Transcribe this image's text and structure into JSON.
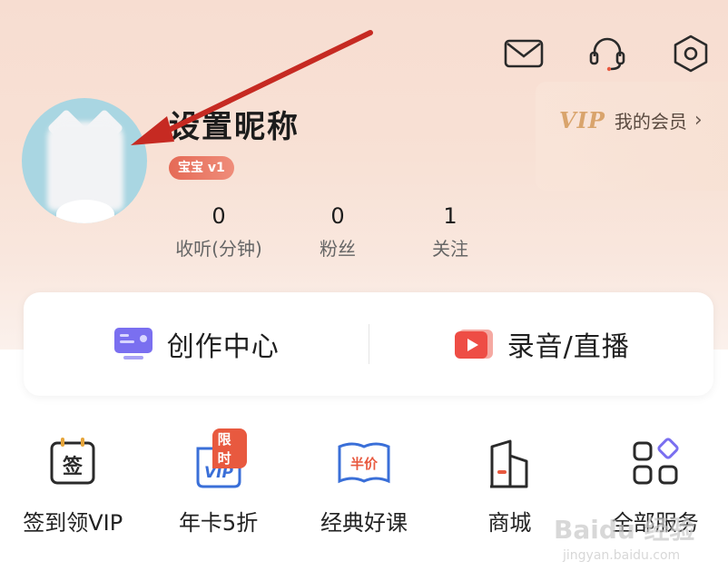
{
  "header": {
    "icons": [
      "mail-icon",
      "headset-icon",
      "settings-hexagon-icon"
    ]
  },
  "profile": {
    "nickname": "设置昵称",
    "level_badge": "宝宝 v1",
    "stats": [
      {
        "value": "0",
        "label": "收听(分钟)"
      },
      {
        "value": "0",
        "label": "粉丝"
      },
      {
        "value": "1",
        "label": "关注"
      }
    ]
  },
  "vip": {
    "logo": "VIP",
    "label": "我的会员",
    "chevron": "›"
  },
  "creator": {
    "left_label": "创作中心",
    "right_label": "录音/直播"
  },
  "services": {
    "items": [
      {
        "label": "签到领VIP",
        "icon_text": "签"
      },
      {
        "label": "年卡5折",
        "icon_text": "VIP",
        "tag": "限时"
      },
      {
        "label": "经典好课",
        "icon_text": "半价"
      },
      {
        "label": "商城"
      },
      {
        "label": "全部服务"
      }
    ]
  },
  "watermark": {
    "text": "Baidu 经验",
    "url": "jingyan.baidu.com"
  },
  "colors": {
    "accent_red": "#e8593f",
    "vip_gold": "#d9a46c",
    "annotation_arrow": "#c62a22"
  }
}
